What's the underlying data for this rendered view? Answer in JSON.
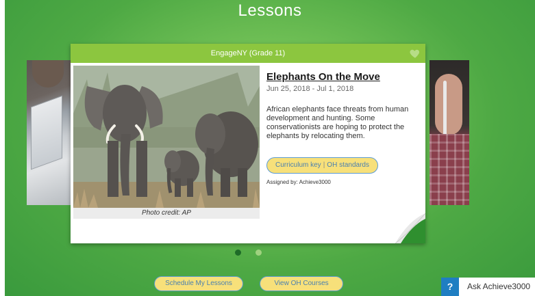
{
  "page": {
    "title": "Lessons"
  },
  "card": {
    "header": "EngageNY (Grade 11)",
    "favorite_icon": "heart-icon",
    "title": "Elephants On the Move",
    "dates": "Jun 25, 2018 - Jul 1, 2018",
    "description": "African elephants face threats from human development and hunting. Some conservationists are hoping to protect the elephants by relocating them.",
    "tags": {
      "first": "Curriculum key",
      "separator": "|",
      "second": "OH standards"
    },
    "assigned_by": "Assigned by: Achieve3000",
    "photo_credit": "Photo credit: AP"
  },
  "pagination": {
    "total": 2,
    "active": 1
  },
  "buttons": {
    "schedule": "Schedule My Lessons",
    "courses": "View OH Courses"
  },
  "help": {
    "icon": "?",
    "label": "Ask Achieve3000"
  },
  "colors": {
    "header": "#8cc63f",
    "accent_button": "#f7e07a",
    "help_icon": "#1f7ec2"
  }
}
